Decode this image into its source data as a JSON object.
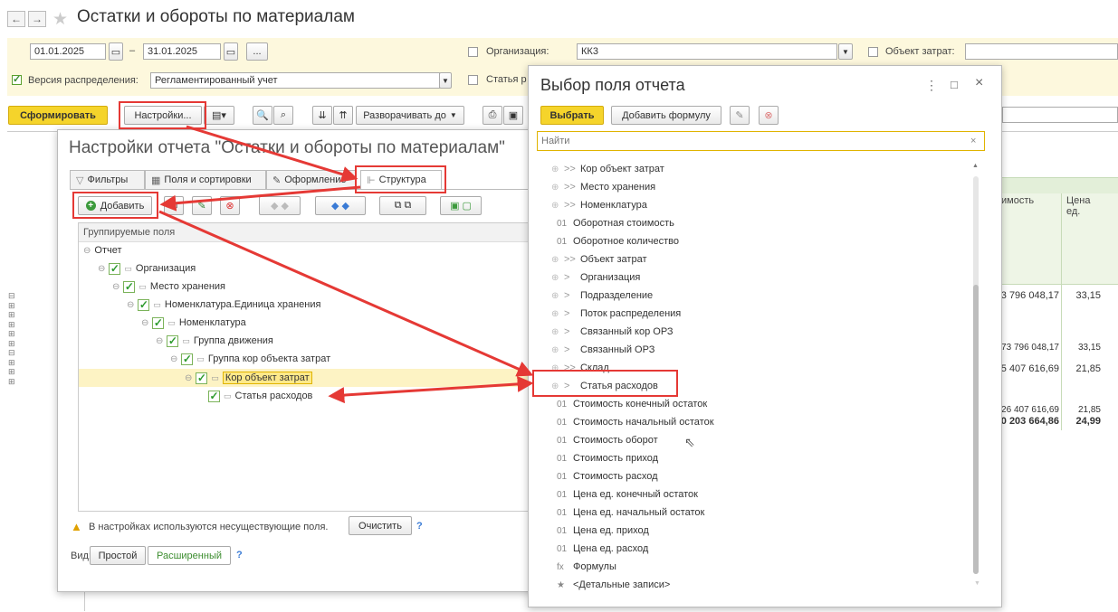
{
  "window_title": "Остатки и обороты по материалам",
  "nav": {
    "back": "←",
    "forward": "→",
    "star": "★"
  },
  "params": {
    "date_from": "01.01.2025",
    "date_sep": "–",
    "date_to": "31.01.2025",
    "dots": "...",
    "org_label": "Организация:",
    "org_value": "КК3",
    "cost_object_label": "Объект затрат:",
    "version_label": "Версия распределения:",
    "version_value": "Регламентированный учет",
    "expense_item_label": "Статья р"
  },
  "toolbar": {
    "generate": "Сформировать",
    "settings": "Настройки...",
    "expand_to": "Разворачивать до"
  },
  "report": {
    "col_cost": "имость",
    "col_price": "Цена\nед.",
    "rows": [
      {
        "cost": "3 796 048,17",
        "price": "33,15"
      },
      {
        "cost": "73 796 048,17",
        "price": "33,15"
      },
      {
        "cost": "5 407 616,69",
        "price": "21,85"
      },
      {
        "cost": "26 407 616,69",
        "price": "21,85"
      },
      {
        "cost": "0 203 664,86",
        "price": "24,99"
      }
    ]
  },
  "settings": {
    "title": "Настройки отчета \"Остатки и обороты по материалам\"",
    "tabs": [
      "Фильтры",
      "Поля и сортировки",
      "Оформление",
      "Структура"
    ],
    "add_button": "Добавить",
    "column_header": "Группируемые поля",
    "tree": [
      {
        "label": "Отчет"
      },
      {
        "label": "Организация"
      },
      {
        "label": "Место хранения"
      },
      {
        "label": "Номенклатура.Единица хранения"
      },
      {
        "label": "Номенклатура"
      },
      {
        "label": "Группа движения"
      },
      {
        "label": "Группа кор объекта затрат"
      },
      {
        "label": "Кор объект затрат"
      },
      {
        "label": "Статья расходов"
      }
    ],
    "warning": "В настройках используются несуществующие поля.",
    "clear_button": "Очистить",
    "help": "?",
    "view_label": "Вид:",
    "view_simple": "Простой",
    "view_extended": "Расширенный"
  },
  "field_choice": {
    "title": "Выбор поля отчета",
    "select_button": "Выбрать",
    "add_formula_button": "Добавить формулу",
    "search_placeholder": "Найти",
    "fields": [
      {
        "prefix": ">>",
        "label": "Кор объект затрат"
      },
      {
        "prefix": ">>",
        "label": "Место хранения"
      },
      {
        "prefix": ">>",
        "label": "Номенклатура"
      },
      {
        "prefix": "01",
        "label": "Оборотная стоимость"
      },
      {
        "prefix": "01",
        "label": "Оборотное количество"
      },
      {
        "prefix": ">>",
        "label": "Объект затрат"
      },
      {
        "prefix": ">",
        "label": "Организация"
      },
      {
        "prefix": ">",
        "label": "Подразделение"
      },
      {
        "prefix": ">",
        "label": "Поток распределения"
      },
      {
        "prefix": ">",
        "label": "Связанный кор ОРЗ"
      },
      {
        "prefix": ">",
        "label": "Связанный ОРЗ"
      },
      {
        "prefix": ">>",
        "label": "Склад"
      },
      {
        "prefix": ">",
        "label": "Статья расходов"
      },
      {
        "prefix": "01",
        "label": "Стоимость конечный остаток"
      },
      {
        "prefix": "01",
        "label": "Стоимость начальный остаток"
      },
      {
        "prefix": "01",
        "label": "Стоимость оборот"
      },
      {
        "prefix": "01",
        "label": "Стоимость приход"
      },
      {
        "prefix": "01",
        "label": "Стоимость расход"
      },
      {
        "prefix": "01",
        "label": "Цена ед. конечный остаток"
      },
      {
        "prefix": "01",
        "label": "Цена ед. начальный остаток"
      },
      {
        "prefix": "01",
        "label": "Цена ед. приход"
      },
      {
        "prefix": "01",
        "label": "Цена ед. расход"
      },
      {
        "prefix": "fx",
        "label": "Формулы"
      },
      {
        "prefix": "★",
        "label": "<Детальные записи>"
      }
    ]
  },
  "colors": {
    "highlight_red": "#e53935",
    "accent_yellow": "#f5d42b",
    "check_green": "#2e9b2e"
  }
}
